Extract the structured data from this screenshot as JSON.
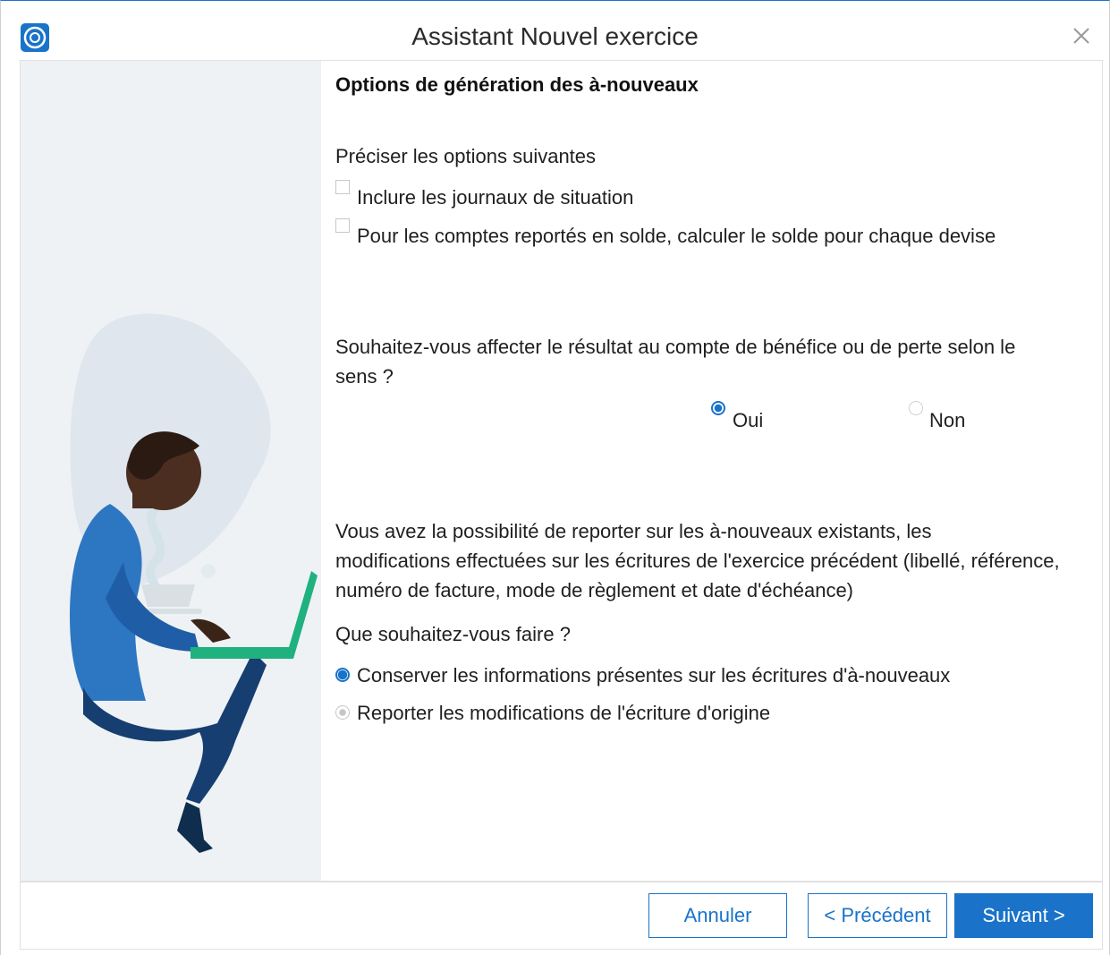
{
  "window": {
    "title": "Assistant Nouvel exercice"
  },
  "page": {
    "heading": "Options de génération des à-nouveaux",
    "options_intro": "Préciser les options suivantes",
    "checkboxes": [
      {
        "label": "Inclure les journaux de situation",
        "checked": false
      },
      {
        "label": "Pour les comptes reportés en solde, calculer le solde pour chaque devise",
        "checked": false
      }
    ],
    "question1_line1": "Souhaitez-vous affecter le résultat au compte de bénéfice ou de perte selon le",
    "question1_line2": "sens ?",
    "radio_oui": "Oui",
    "radio_non": "Non",
    "info_line1": "Vous avez la possibilité de reporter sur les à-nouveaux existants, les",
    "info_line2": "modifications effectuées sur les écritures de l'exercice précédent (libellé, référence,",
    "info_line3": "numéro de facture, mode de règlement et date d'échéance)",
    "question2": "Que souhaitez-vous faire ?",
    "radio_keep": "Conserver les informations présentes sur les écritures d'à-nouveaux",
    "radio_report": "Reporter les modifications de l'écriture d'origine"
  },
  "footer": {
    "cancel": "Annuler",
    "previous": "< Précédent",
    "next": "Suivant >"
  },
  "colors": {
    "accent": "#1a73c9",
    "illustration_bg": "#eef2f5"
  }
}
